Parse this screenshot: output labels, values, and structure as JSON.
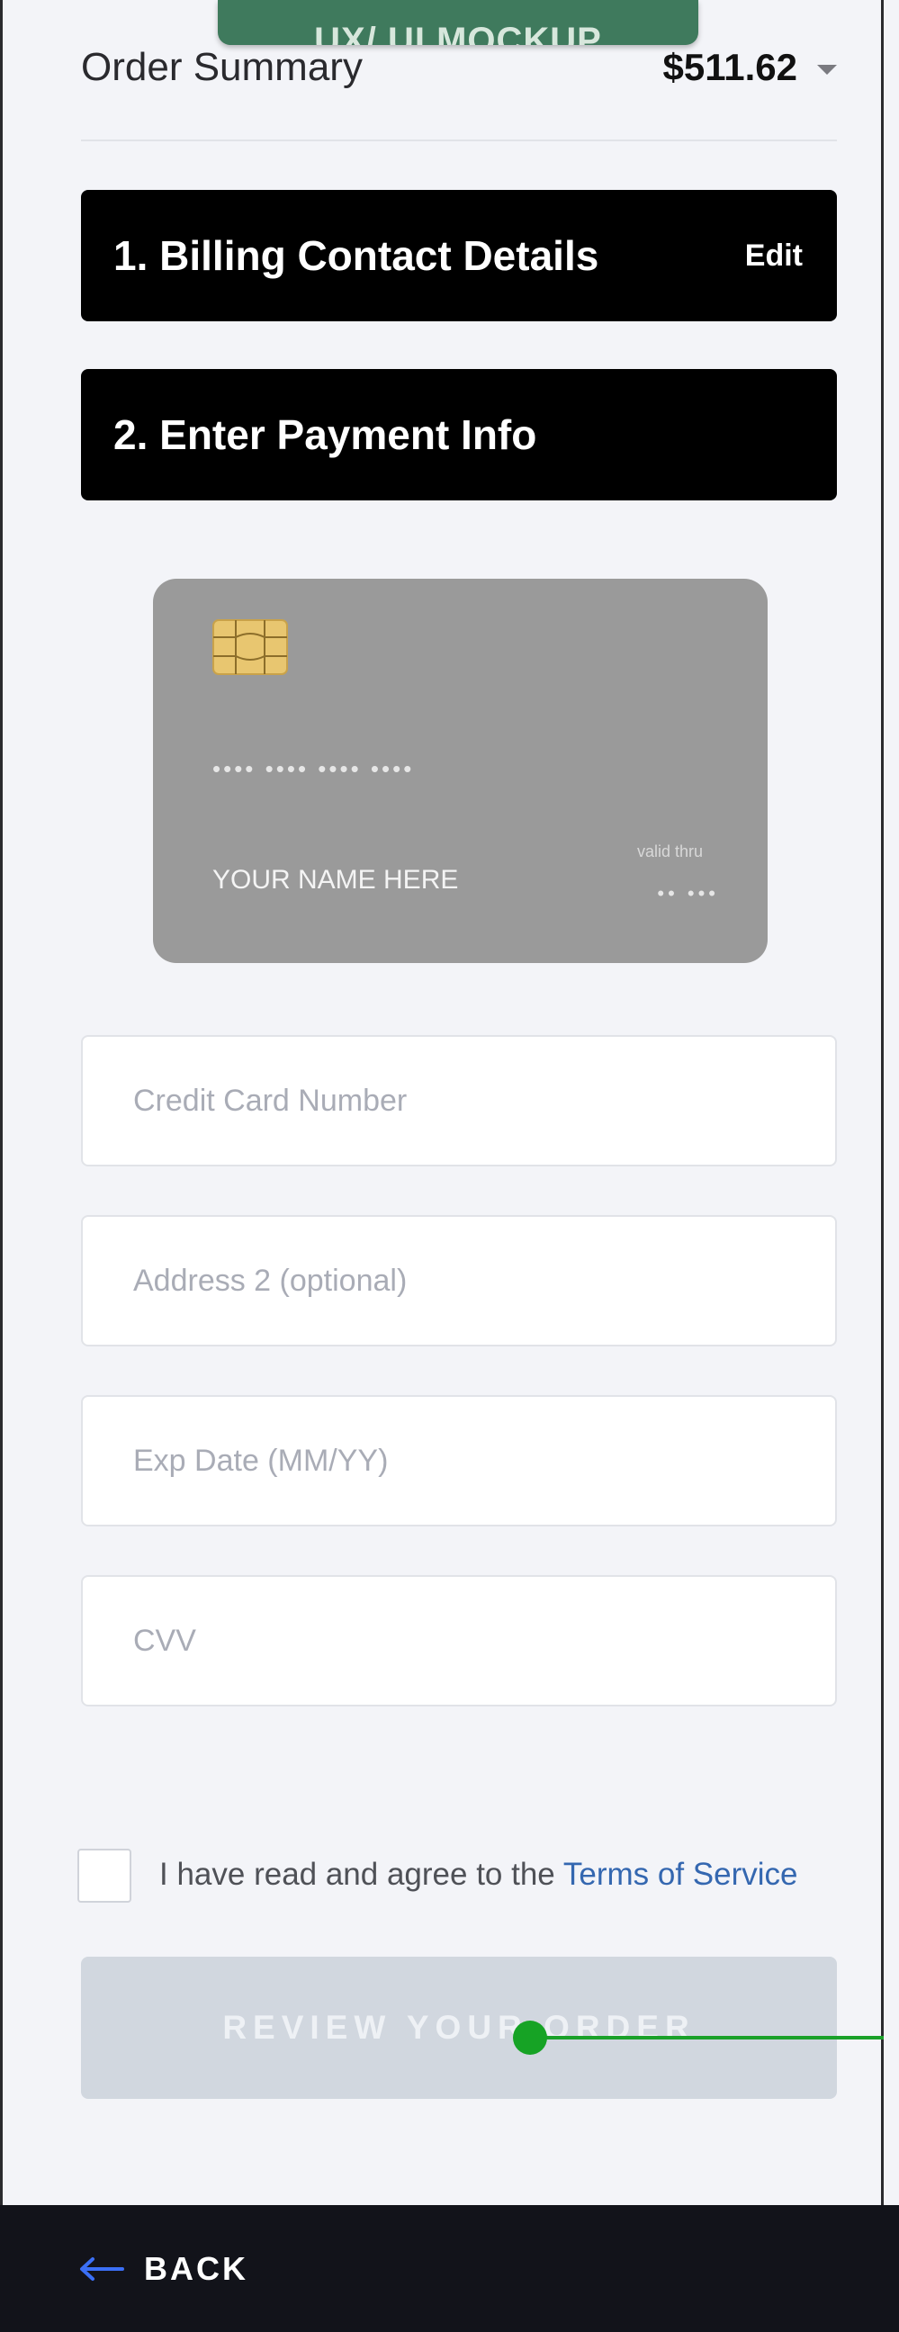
{
  "mockup_tag": "UX/ UI MOCKUP",
  "order_summary": {
    "label": "Order Summary",
    "amount": "$511.62"
  },
  "steps": [
    {
      "title": "1. Billing Contact Details",
      "action": "Edit"
    },
    {
      "title": "2. Enter Payment Info"
    }
  ],
  "card_preview": {
    "number_mask": "•••• •••• •••• ••••",
    "name": "YOUR NAME HERE",
    "valid_thru_label": "valid thru",
    "expiry_mask": "•• •••"
  },
  "fields": [
    {
      "placeholder": "Credit Card Number",
      "value": ""
    },
    {
      "placeholder": "Address 2 (optional)",
      "value": ""
    },
    {
      "placeholder": "Exp Date (MM/YY)",
      "value": ""
    },
    {
      "placeholder": "CVV",
      "value": ""
    }
  ],
  "terms": {
    "text": "I have read and agree to the ",
    "link": "Terms of Service",
    "checked": false
  },
  "review_button": "REVIEW YOUR ORDER",
  "footer": {
    "back_label": "BACK",
    "back_icon": "arrow-left-icon"
  },
  "colors": {
    "accent_link": "#3467b0",
    "footer_bg": "#12131a",
    "step_bg": "#000000",
    "button_disabled": "#d1d7df",
    "annotation": "#16a325",
    "mockup_tag_bg": "#3f7a5d"
  }
}
